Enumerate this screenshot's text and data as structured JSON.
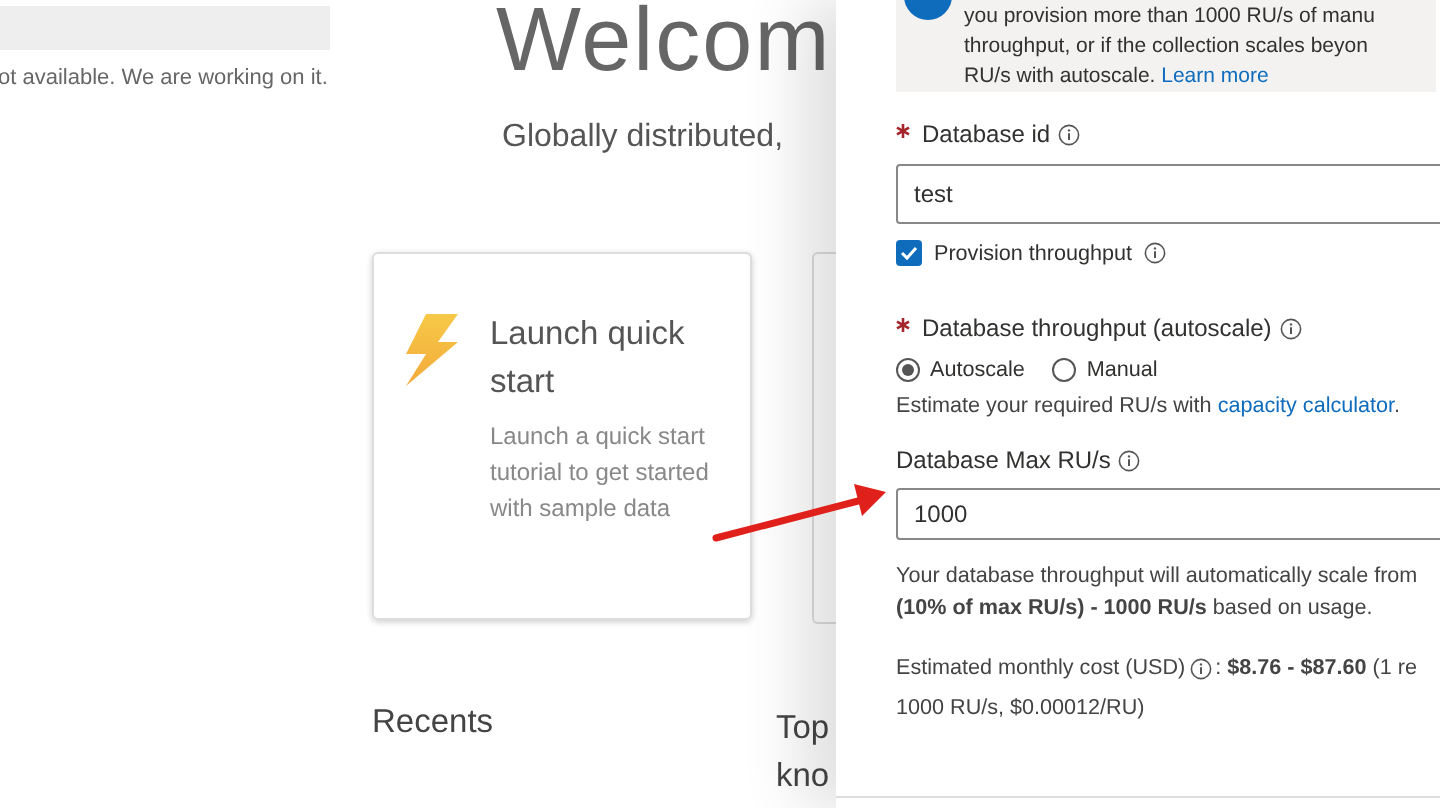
{
  "home": {
    "notice": "ot available. We are working on it.",
    "title": "Welcom",
    "subtitle": "Globally distributed,",
    "cards": [
      {
        "title": "Launch quick start",
        "description": "Launch a quick start tutorial to get started with sample data"
      }
    ],
    "recents_heading": "Recents",
    "top_heading": [
      "Top",
      "kno"
    ]
  },
  "panel": {
    "info_lines": [
      "you provision more than 1000 RU/s of manu",
      "throughput, or if the collection scales beyon",
      "RU/s with autoscale."
    ],
    "info_link": "Learn more",
    "database_id": {
      "label": "Database id",
      "required": true,
      "value": "test"
    },
    "provision_throughput": {
      "label": "Provision throughput",
      "checked": true
    },
    "throughput": {
      "label": "Database throughput (autoscale)",
      "required": true,
      "options": [
        {
          "label": "Autoscale",
          "selected": true
        },
        {
          "label": "Manual",
          "selected": false
        }
      ]
    },
    "estimate": {
      "text": "Estimate your required RU/s with",
      "link": "capacity calculator",
      "end": "."
    },
    "max_ru": {
      "label": "Database Max RU/s",
      "required": false,
      "value": "1000"
    },
    "scale_lines": [
      "Your database throughput will automatically scale from",
      "**(10% of max RU/s) - 1000 RU/s** based on usage."
    ],
    "cost": {
      "label": "Estimated monthly cost (USD)",
      "rest": ": **$8.76 - $87.60** (1 re",
      "line2": "1000 RU/s, $0.00012/RU)"
    }
  }
}
